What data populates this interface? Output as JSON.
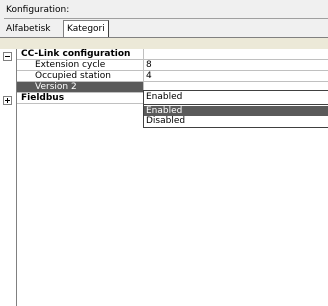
{
  "header": {
    "config_label": "Konfiguration:"
  },
  "tabs": [
    {
      "label": "Alfabetisk",
      "active": false
    },
    {
      "label": "Kategori",
      "active": true
    }
  ],
  "grid": {
    "categories": [
      {
        "name": "CC-Link configuration",
        "expanded": true,
        "properties": [
          {
            "name": "Extension cycle",
            "value": "8"
          },
          {
            "name": "Occupied station",
            "value": "4"
          },
          {
            "name": "Version 2",
            "value": "Enabled",
            "selected": true
          }
        ]
      },
      {
        "name": "Fieldbus",
        "expanded": false,
        "properties": []
      }
    ]
  },
  "dropdown": {
    "current_value": "Enabled",
    "options": [
      {
        "label": "Enabled",
        "highlighted": true
      },
      {
        "label": "Disabled",
        "highlighted": false
      }
    ]
  },
  "colors": {
    "selection": "#5a5a5a",
    "grid_line": "#c0c0c0",
    "panel": "#f0f0f0"
  }
}
